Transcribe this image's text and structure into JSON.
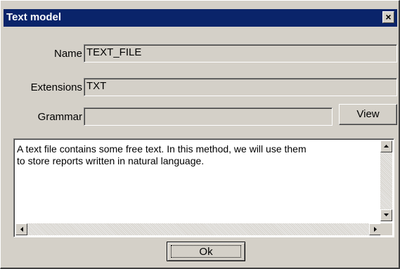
{
  "window": {
    "title": "Text model",
    "close_label": "×"
  },
  "form": {
    "name_label": "Name",
    "name_value": "TEXT_FILE",
    "extensions_label": "Extensions",
    "extensions_value": "TXT",
    "grammar_label": "Grammar",
    "grammar_value": "",
    "view_button": "View"
  },
  "description": {
    "text": "A text file contains some free text. In this method, we will use them\nto store reports written in natural language."
  },
  "footer": {
    "ok_button": "Ok"
  }
}
